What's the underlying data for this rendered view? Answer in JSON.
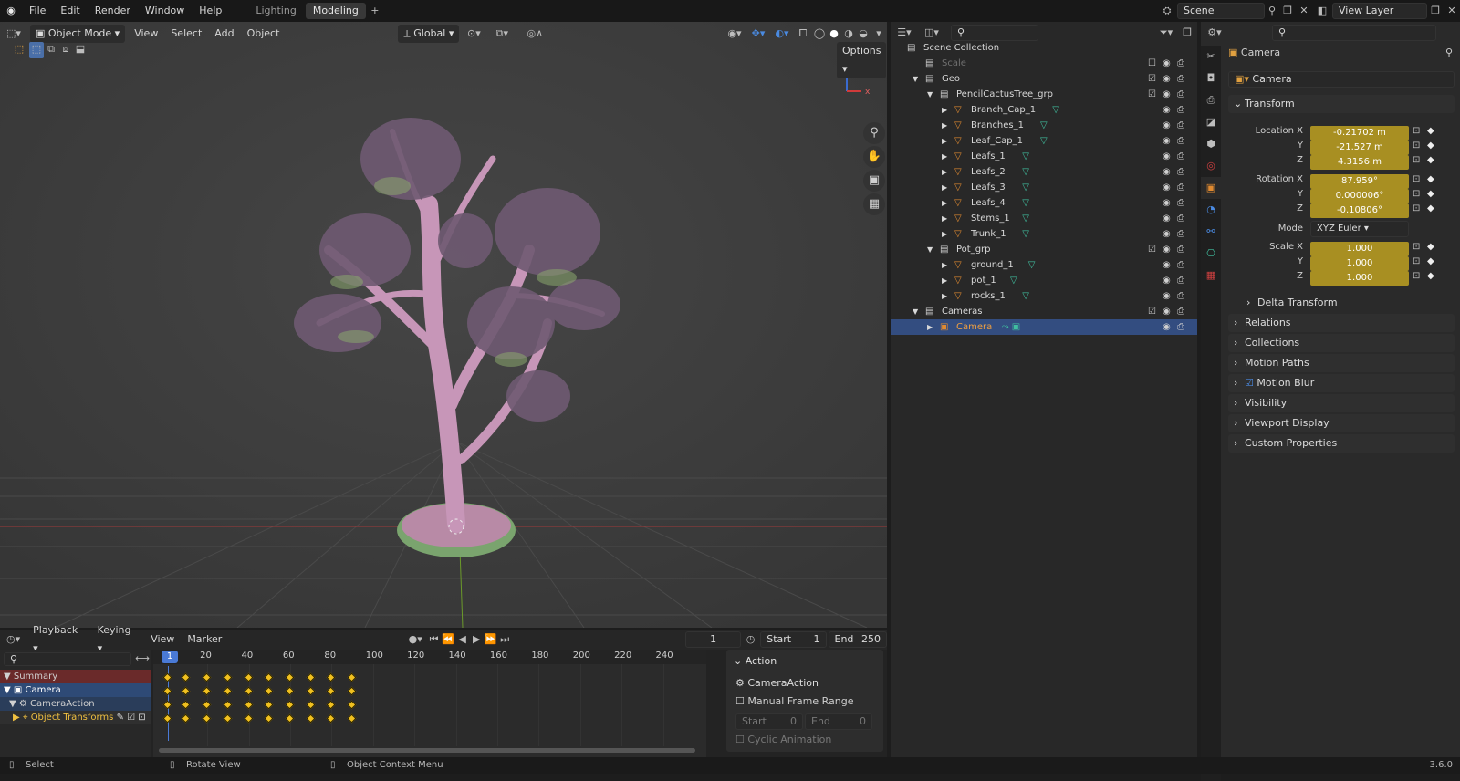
{
  "topbar": {
    "menus": [
      "File",
      "Edit",
      "Render",
      "Window",
      "Help"
    ],
    "workspaces": [
      "Lighting",
      "Modeling"
    ],
    "scene": "Scene",
    "view_layer": "View Layer"
  },
  "viewport": {
    "mode": "Object Mode",
    "menus": [
      "View",
      "Select",
      "Add",
      "Object"
    ],
    "orientation": "Global",
    "options": "Options"
  },
  "timeline": {
    "menus": [
      "Playback",
      "Keying",
      "View",
      "Marker"
    ],
    "current_frame": "1",
    "start_label": "Start",
    "start": "1",
    "end_label": "End",
    "end": "250",
    "ticks": [
      "1",
      "20",
      "40",
      "60",
      "80",
      "100",
      "120",
      "140",
      "160",
      "180",
      "200",
      "220",
      "240"
    ],
    "channels": [
      "Summary",
      "Camera",
      "CameraAction",
      "Object Transforms"
    ],
    "keyframes": [
      1,
      10,
      20,
      30,
      40,
      50,
      60,
      70,
      80,
      90
    ],
    "action_panel": {
      "title": "Action",
      "action_name": "CameraAction",
      "manual_range": "Manual Frame Range",
      "start_label": "Start",
      "start": "0",
      "end_label": "End",
      "end": "0",
      "cyclic": "Cyclic Animation"
    }
  },
  "outliner": {
    "root": "Scene Collection",
    "items": [
      {
        "label": "Scale",
        "depth": 1
      },
      {
        "label": "Geo",
        "depth": 1
      },
      {
        "label": "PencilCactusTree_grp",
        "depth": 2
      },
      {
        "label": "Branch_Cap_1",
        "depth": 3
      },
      {
        "label": "Branches_1",
        "depth": 3
      },
      {
        "label": "Leaf_Cap_1",
        "depth": 3
      },
      {
        "label": "Leafs_1",
        "depth": 3
      },
      {
        "label": "Leafs_2",
        "depth": 3
      },
      {
        "label": "Leafs_3",
        "depth": 3
      },
      {
        "label": "Leafs_4",
        "depth": 3
      },
      {
        "label": "Stems_1",
        "depth": 3
      },
      {
        "label": "Trunk_1",
        "depth": 3
      },
      {
        "label": "Pot_grp",
        "depth": 2
      },
      {
        "label": "ground_1",
        "depth": 3
      },
      {
        "label": "pot_1",
        "depth": 3
      },
      {
        "label": "rocks_1",
        "depth": 3
      },
      {
        "label": "Cameras",
        "depth": 1
      },
      {
        "label": "Camera",
        "depth": 2
      }
    ]
  },
  "properties": {
    "object_title": "Camera",
    "object_name": "Camera",
    "transform": "Transform",
    "location": {
      "label": "Location X",
      "x": "-0.21702 m",
      "y": "-21.527 m",
      "z": "4.3156 m"
    },
    "rotation": {
      "label": "Rotation X",
      "x": "87.959°",
      "y": "0.000006°",
      "z": "-0.10806°"
    },
    "mode_label": "Mode",
    "mode": "XYZ Euler",
    "scale": {
      "label": "Scale X",
      "x": "1.000",
      "y": "1.000",
      "z": "1.000"
    },
    "axis_y": "Y",
    "axis_z": "Z",
    "panels": [
      "Delta Transform",
      "Relations",
      "Collections",
      "Motion Paths",
      "Motion Blur",
      "Visibility",
      "Viewport Display",
      "Custom Properties"
    ]
  },
  "status": {
    "select": "Select",
    "rotate": "Rotate View",
    "context": "Object Context Menu",
    "version": "3.6.0"
  }
}
